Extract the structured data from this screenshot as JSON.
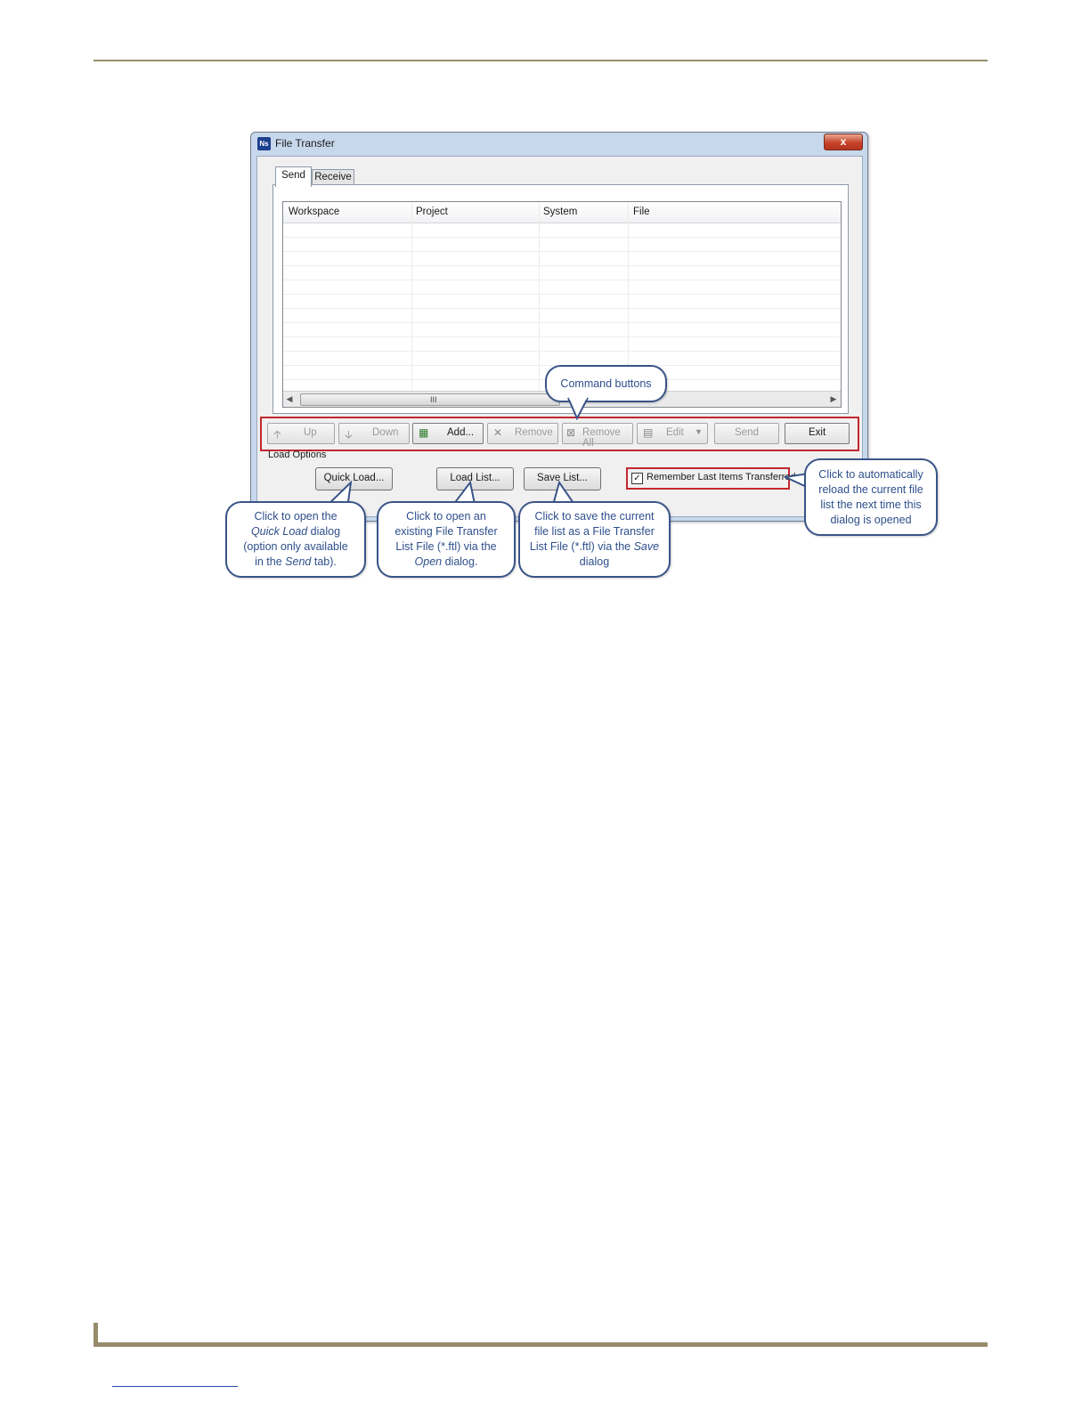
{
  "window": {
    "title": "File Transfer",
    "app_icon": "Ns",
    "close_label": "x"
  },
  "tabs": [
    {
      "label": "Send"
    },
    {
      "label": "Receive"
    }
  ],
  "grid": {
    "columns": [
      "Workspace",
      "Project",
      "System",
      "File"
    ],
    "scroll_grip": "III"
  },
  "command_buttons": [
    {
      "label": "Up",
      "icon": "arrow-up-icon",
      "glyph": "🡡"
    },
    {
      "label": "Down",
      "icon": "arrow-down-icon",
      "glyph": "🡣"
    },
    {
      "label": "Add...",
      "icon": "add-file-icon",
      "glyph": "▦"
    },
    {
      "label": "Remove",
      "icon": "remove-x-icon",
      "glyph": "✕"
    },
    {
      "label": "Remove All",
      "icon": "remove-all-icon",
      "glyph": "⊠"
    },
    {
      "label": "Edit",
      "icon": "edit-document-icon",
      "glyph": "▤"
    },
    {
      "label": "Send",
      "icon": "",
      "glyph": ""
    },
    {
      "label": "Exit",
      "icon": "",
      "glyph": ""
    }
  ],
  "load_options": {
    "label": "Load Options",
    "quick_load": "Quick Load...",
    "load_list": "Load List...",
    "save_list": "Save List...",
    "remember_checkbox": "Remember Last Items Transferred",
    "remember_checked": true
  },
  "callouts": {
    "command_buttons": "Command buttons",
    "quick_load": {
      "line1": "Click to open the",
      "line2_em": "Quick Load",
      "line2": " dialog",
      "line3": "(option only available",
      "line4a": "in the ",
      "line4_em": "Send",
      "line4b": " tab)."
    },
    "load_list": {
      "line1": "Click to open an",
      "line2": "existing File Transfer",
      "line3": "List File (*.ftl) via the",
      "line4_em": "Open",
      "line4": " dialog."
    },
    "save_list": {
      "line1": "Click to save the current",
      "line2": "file list as a File Transfer",
      "line3": "List File (*.ftl) via the ",
      "line3_em": "Save",
      "line4": "dialog"
    },
    "remember": {
      "line1": "Click to automatically",
      "line2": "reload the current file",
      "line3": "list the next time this",
      "line4": "dialog is opened"
    }
  },
  "colors": {
    "highlight": "#c1272d",
    "callout_border": "#3a5488",
    "callout_text": "#2e4f8c",
    "page_rule": "#958c6a"
  }
}
